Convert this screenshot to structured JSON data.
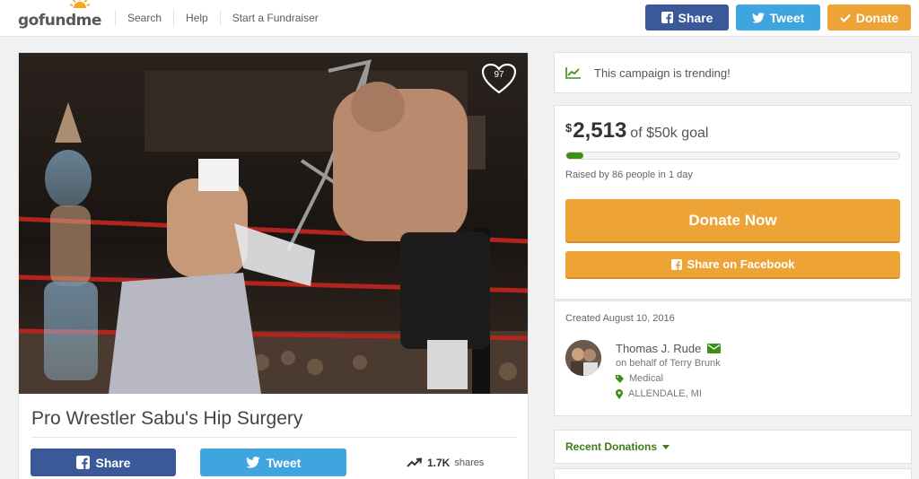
{
  "header": {
    "logo_text": "gofundme",
    "nav": [
      "Search",
      "Help",
      "Start a Fundraiser"
    ],
    "share_label": "Share",
    "tweet_label": "Tweet",
    "donate_label": "Donate"
  },
  "campaign": {
    "title": "Pro Wrestler Sabu's Hip Surgery",
    "hearts": "97",
    "share_label": "Share",
    "tweet_label": "Tweet",
    "shares_count": "1.7K",
    "shares_label": "shares"
  },
  "sidebar": {
    "trending_text": "This campaign is trending!",
    "currency": "$",
    "amount": "2,513",
    "goal_text": "of $50k goal",
    "progress_fraction": 0.05,
    "raised_text": "Raised by 86 people in 1 day",
    "donate_now_label": "Donate Now",
    "fb_share_label": "Share on Facebook",
    "created_text": "Created August 10, 2016",
    "organizer_name": "Thomas J. Rude",
    "on_behalf": "on behalf of Terry Brunk",
    "category": "Medical",
    "location": "ALLENDALE, MI",
    "recent_donations_label": "Recent Donations"
  },
  "colors": {
    "facebook": "#3b5998",
    "twitter": "#3fa5e0",
    "donate": "#eea336",
    "progress": "#3e8e1a",
    "accent_green": "#3e7a1a"
  }
}
